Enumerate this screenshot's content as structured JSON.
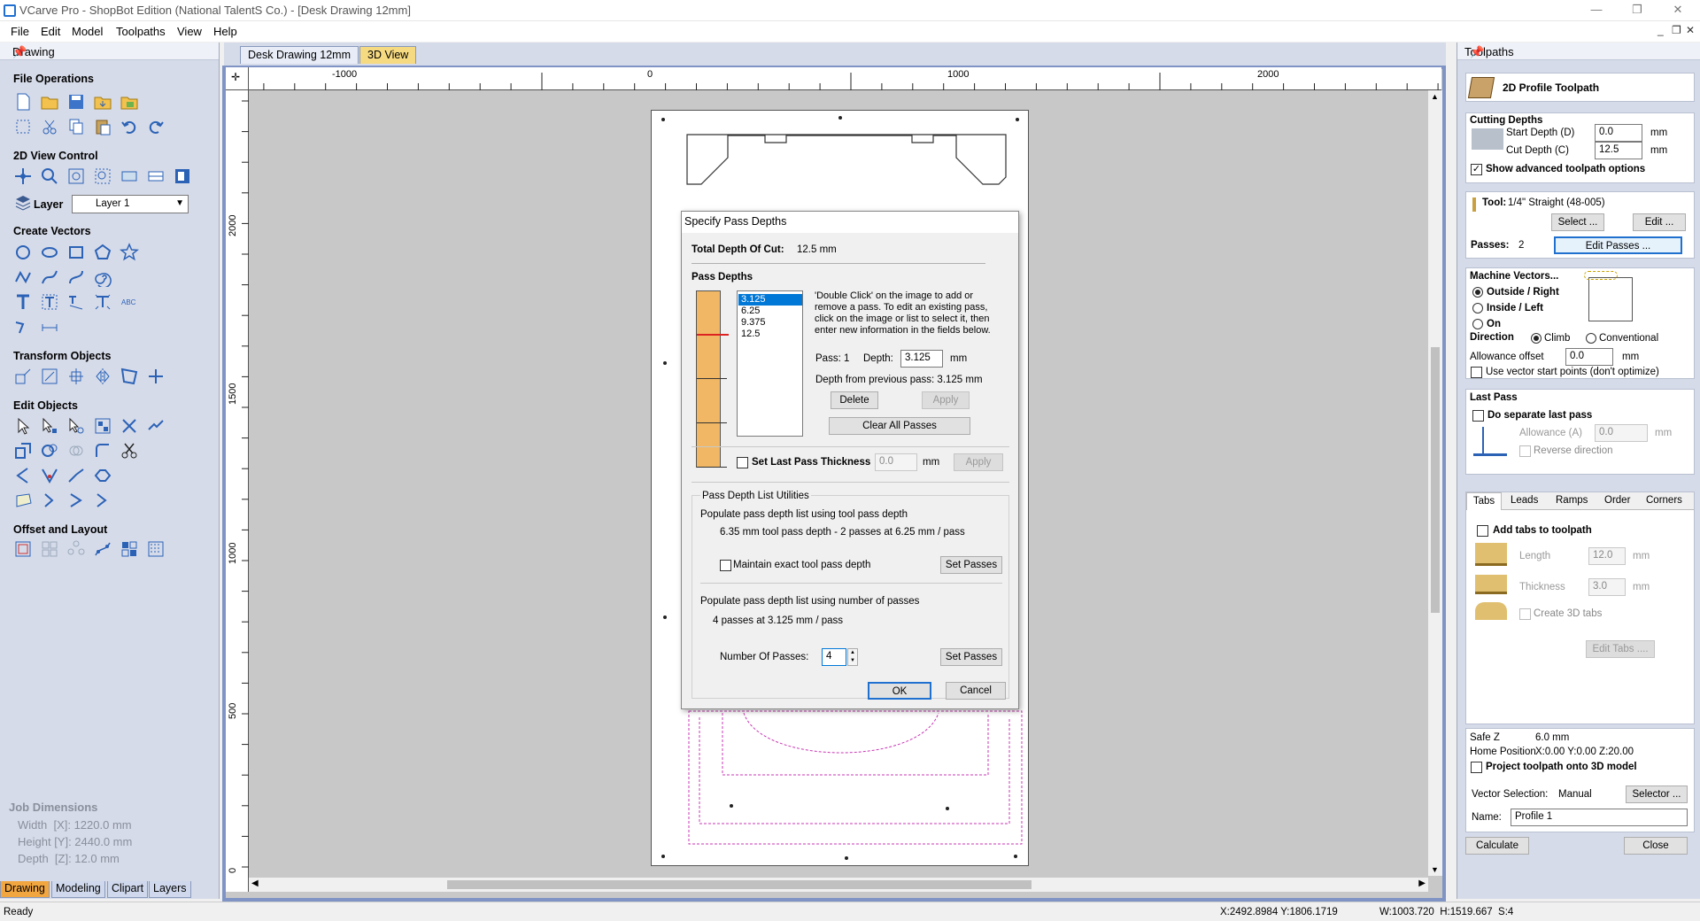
{
  "window": {
    "title": "VCarve Pro - ShopBot Edition (National TalentS Co.) - [Desk Drawing 12mm]",
    "controls": {
      "minimize": "—",
      "restore": "❐",
      "close": "✕"
    }
  },
  "menu": [
    "File",
    "Edit",
    "Model",
    "Toolpaths",
    "View",
    "Help"
  ],
  "mdi_controls": {
    "minimize": "_",
    "restore": "❐",
    "close": "✕"
  },
  "left_panel": {
    "header": "Drawing",
    "sections": {
      "file_ops": "File Operations",
      "view_2d": "2D View Control",
      "layer_label": "Layer",
      "layer_value": "Layer 1",
      "create_vectors": "Create Vectors",
      "transform": "Transform Objects",
      "edit": "Edit Objects",
      "offset": "Offset and Layout"
    },
    "job": {
      "title": "Job Dimensions",
      "width": "Width  [X]: 1220.0 mm",
      "height": "Height [Y]: 2440.0 mm",
      "depth": "Depth  [Z]: 12.0 mm"
    },
    "tabs": [
      "Drawing",
      "Modeling",
      "Clipart",
      "Layers"
    ]
  },
  "doc_tabs": [
    "Desk Drawing 12mm",
    "3D View"
  ],
  "rulers": {
    "h_labels": [
      "-1000",
      "0",
      "1000",
      "2000"
    ],
    "v_labels": [
      "2000",
      "1500",
      "1000",
      "500",
      "0"
    ]
  },
  "dialog": {
    "title": "Specify Pass Depths",
    "total_label": "Total Depth Of Cut:",
    "total_value": "12.5 mm",
    "pass_depths_heading": "Pass Depths",
    "pass_list": [
      "3.125",
      "6.25",
      "9.375",
      "12.5"
    ],
    "selected_pass": "3.125",
    "help": "'Double Click' on the image to add or remove a pass. To edit an existing pass, click on the image or list to select it, then enter new information in the fields below.",
    "pass_label": "Pass: 1",
    "depth_label": "Depth:",
    "depth_value": "3.125",
    "depth_unit": "mm",
    "from_prev": "Depth from previous pass:  3.125 mm",
    "delete_btn": "Delete",
    "apply_btn": "Apply",
    "clear_btn": "Clear All Passes",
    "set_last_label": "Set Last Pass Thickness",
    "set_last_value": "0.0",
    "set_last_unit": "mm",
    "set_last_apply": "Apply",
    "utils_title": "Pass Depth List Utilities",
    "tool_pop_label": "Populate pass depth list using tool pass depth",
    "tool_pop_info": "6.35 mm tool pass depth - 2 passes at 6.25 mm / pass",
    "maintain_label": "Maintain exact tool pass depth",
    "set_passes_btn": "Set Passes",
    "num_pop_label": "Populate pass depth list using number of passes",
    "num_pop_info": "4 passes at 3.125 mm / pass",
    "num_passes_label": "Number Of Passes:",
    "num_passes_value": "4",
    "ok_btn": "OK",
    "cancel_btn": "Cancel"
  },
  "right_panel": {
    "header": "Toolpaths",
    "title": "2D Profile Toolpath",
    "cutting_depths": "Cutting Depths",
    "start_depth_label": "Start Depth (D)",
    "start_depth_value": "0.0",
    "cut_depth_label": "Cut Depth (C)",
    "cut_depth_value": "12.5",
    "unit": "mm",
    "show_adv": "Show advanced toolpath options",
    "tool_label": "Tool:",
    "tool_value": "1/4\" Straight  (48-005)",
    "select_btn": "Select ...",
    "edit_btn": "Edit ...",
    "passes_label": "Passes:",
    "passes_value": "2",
    "edit_passes_btn": "Edit Passes ...",
    "machine_vectors": "Machine Vectors...",
    "outside": "Outside / Right",
    "inside": "Inside / Left",
    "on": "On",
    "direction_label": "Direction",
    "climb": "Climb",
    "conventional": "Conventional",
    "allowance_label": "Allowance offset",
    "allowance_value": "0.0",
    "use_start_points": "Use vector start points (don't optimize)",
    "last_pass": "Last Pass",
    "do_separate": "Do separate last pass",
    "allowance_a": "Allowance (A)",
    "allowance_a_value": "0.0",
    "reverse_dir": "Reverse direction",
    "tabs": [
      "Tabs",
      "Leads",
      "Ramps",
      "Order",
      "Corners"
    ],
    "add_tabs": "Add tabs to toolpath",
    "length_label": "Length",
    "length_value": "12.0",
    "thickness_label": "Thickness",
    "thickness_value": "3.0",
    "create_3d_tabs": "Create 3D tabs",
    "edit_tabs_btn": "Edit Tabs ....",
    "safe_z_label": "Safe Z",
    "safe_z_value": "6.0 mm",
    "home_label": "Home Position",
    "home_value": "X:0.00 Y:0.00 Z:20.00",
    "project_label": "Project toolpath onto 3D model",
    "vec_sel_label": "Vector Selection:",
    "vec_sel_value": "Manual",
    "selector_btn": "Selector ...",
    "name_label": "Name:",
    "name_value": "Profile 1",
    "calculate_btn": "Calculate",
    "close_btn": "Close"
  },
  "status": {
    "left": "Ready",
    "coords": "X:2492.8984 Y:1806.1719",
    "dims": "W:1003.720  H:1519.667  S:4"
  }
}
